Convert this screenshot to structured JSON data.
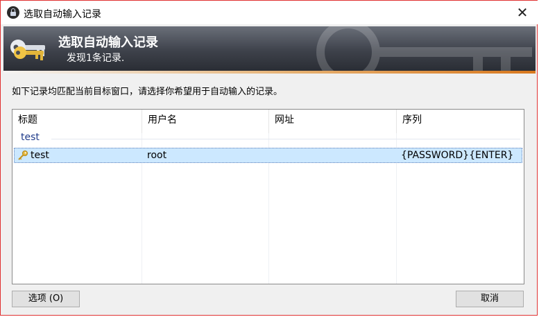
{
  "window": {
    "title": "选取自动输入记录",
    "close_glyph": "✕"
  },
  "banner": {
    "title": "选取自动输入记录",
    "subtitle": "发现1条记录."
  },
  "instruction": "如下记录均匹配当前目标窗口，请选择你希望用于自动输入的记录。",
  "list": {
    "columns": [
      "标题",
      "用户名",
      "网址",
      "序列"
    ],
    "group": "test",
    "rows": [
      {
        "icon": "key-icon",
        "title": "test",
        "username": "root",
        "url": "",
        "sequence": "{PASSWORD}{ENTER}",
        "selected": true
      }
    ]
  },
  "buttons": {
    "options": "选项 (O)",
    "cancel": "取消"
  },
  "colors": {
    "banner_dark": "#3e424b",
    "selection": "#cce8ff",
    "group_text": "#1e3a8a",
    "accent_orange": "#d8781e"
  },
  "icons": {
    "app": "lock-icon",
    "banner": "keys-icon",
    "row": "key-icon"
  }
}
